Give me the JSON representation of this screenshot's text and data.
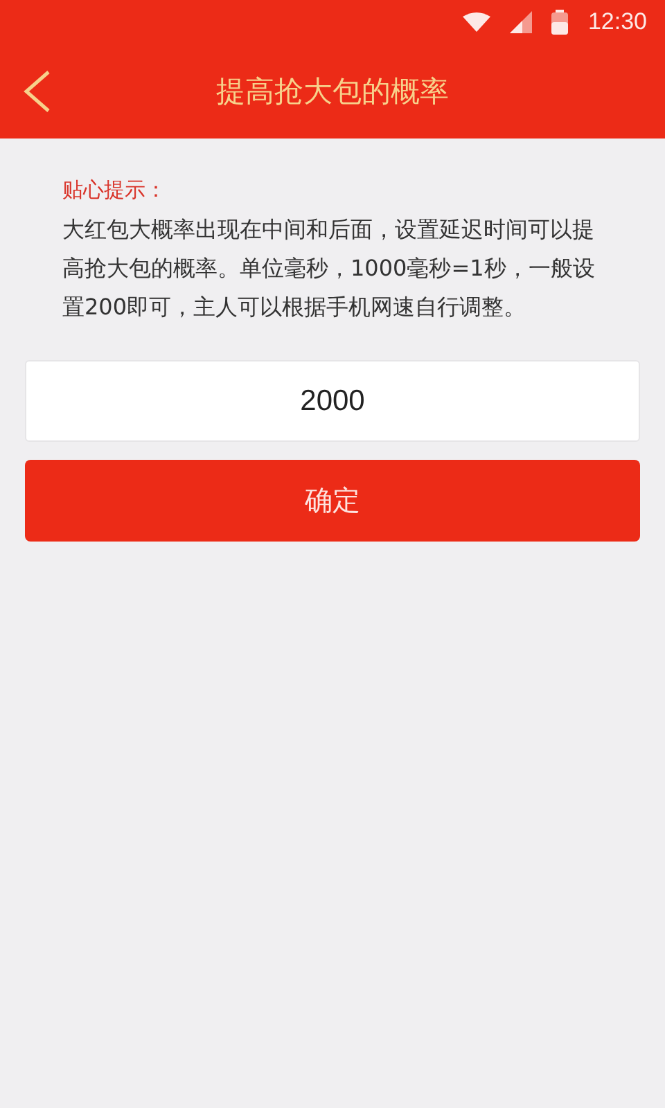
{
  "status_bar": {
    "time": "12:30"
  },
  "header": {
    "title": "提高抢大包的概率"
  },
  "tip": {
    "title": "贴心提示：",
    "text": "大红包大概率出现在中间和后面，设置延迟时间可以提高抢大包的概率。单位毫秒，1000毫秒=1秒，一般设置200即可，主人可以根据手机网速自行调整。"
  },
  "delay_field": {
    "value": "2000"
  },
  "buttons": [
    "确定"
  ]
}
